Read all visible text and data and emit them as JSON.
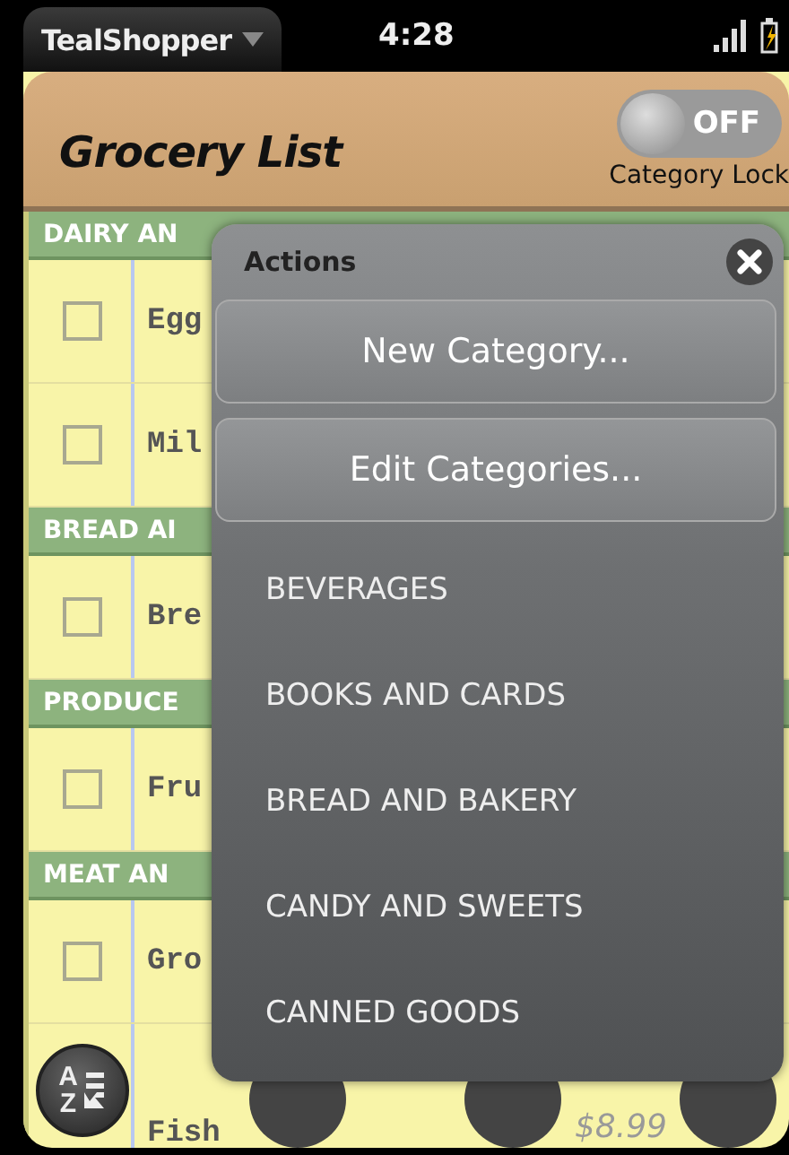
{
  "status_bar": {
    "app_name": "TealShopper",
    "time": "4:28"
  },
  "header": {
    "title": "Grocery List",
    "toggle": {
      "on": false,
      "label": "OFF",
      "caption": "Category Lock"
    }
  },
  "list": [
    {
      "category": "DAIRY AN",
      "items": [
        {
          "name": "Egg",
          "checked": false
        },
        {
          "name": "Mil",
          "checked": false
        }
      ]
    },
    {
      "category": "BREAD AI",
      "items": [
        {
          "name": "Bre",
          "checked": false
        }
      ]
    },
    {
      "category": "PRODUCE",
      "items": [
        {
          "name": "Fru",
          "checked": false
        }
      ]
    },
    {
      "category": "MEAT AN",
      "items": [
        {
          "name": "Gro",
          "checked": false
        },
        {
          "name": "Fish",
          "price": "$8.99"
        }
      ]
    }
  ],
  "sort_button": {
    "letters": [
      "A",
      "Z"
    ]
  },
  "actions_popup": {
    "title": "Actions",
    "buttons": [
      "New Category...",
      "Edit Categories..."
    ],
    "categories": [
      "BEVERAGES",
      "BOOKS AND CARDS",
      "BREAD AND BAKERY",
      "CANDY AND SWEETS",
      "CANNED GOODS"
    ]
  }
}
